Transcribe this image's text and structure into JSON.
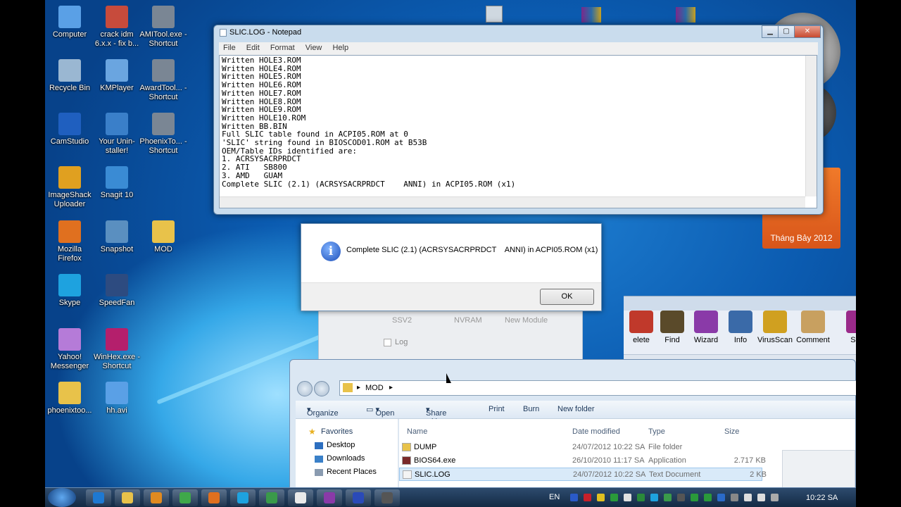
{
  "desktop_icons": [
    {
      "label": "Computer",
      "icon": "computer-icon",
      "color": "#5aa0e6"
    },
    {
      "label": "crack idm 6.x.x - fix b...",
      "icon": "gnome-icon",
      "color": "#c74b3c"
    },
    {
      "label": "AMITool.exe - Shortcut",
      "icon": "amitool-icon",
      "color": "#7a8694"
    },
    {
      "label": "Recycle Bin",
      "icon": "recycle-bin-icon",
      "color": "#9ab7d2"
    },
    {
      "label": "KMPlayer",
      "icon": "kmplayer-icon",
      "color": "#6aa5e0"
    },
    {
      "label": "AwardTool... - Shortcut",
      "icon": "awardtool-icon",
      "color": "#7a8694"
    },
    {
      "label": "CamStudio",
      "icon": "camstudio-icon",
      "color": "#1f5fbf"
    },
    {
      "label": "Your Unin-staller!",
      "icon": "uninstaller-icon",
      "color": "#3a7fc9"
    },
    {
      "label": "PhoenixTo... - Shortcut",
      "icon": "phoenixtool-icon",
      "color": "#7a8694"
    },
    {
      "label": "ImageShack Uploader",
      "icon": "imageshack-icon",
      "color": "#e0a020"
    },
    {
      "label": "Snagit 10",
      "icon": "snagit-icon",
      "color": "#3a8bd4"
    },
    {
      "label": "Mozilla Firefox",
      "icon": "firefox-icon",
      "color": "#e0701f"
    },
    {
      "label": "Snapshot",
      "icon": "snapshot-icon",
      "color": "#5a8fc0"
    },
    {
      "label": "MOD",
      "icon": "folder-icon",
      "color": "#e8c24a"
    },
    {
      "label": "Skype",
      "icon": "skype-icon",
      "color": "#1ea2df"
    },
    {
      "label": "SpeedFan",
      "icon": "speedfan-icon",
      "color": "#2d4b80"
    },
    {
      "label": "Yahoo! Messenger",
      "icon": "yahoo-icon",
      "color": "#b57bd8"
    },
    {
      "label": "WinHex.exe - Shortcut",
      "icon": "winhex-icon",
      "color": "#b41f6c"
    },
    {
      "label": "phoenixtoo...",
      "icon": "folder-icon",
      "color": "#e8c24a"
    },
    {
      "label": "hh.avi",
      "icon": "video-icon",
      "color": "#5aa0e6"
    }
  ],
  "notepad": {
    "title": "SLIC.LOG - Notepad",
    "menu": [
      "File",
      "Edit",
      "Format",
      "View",
      "Help"
    ],
    "lines": [
      "Written HOLE3.ROM",
      "Written HOLE4.ROM",
      "Written HOLE5.ROM",
      "Written HOLE6.ROM",
      "Written HOLE7.ROM",
      "Written HOLE8.ROM",
      "Written HOLE9.ROM",
      "Written HOLE10.ROM",
      "Written BB.BIN",
      "Full SLIC table found in ACPI05.ROM at 0",
      "'SLIC' string found in BIOSCOD01.ROM at B53B",
      "OEM/Table IDs identified are:",
      "1. ACRSYSACRPRDCT",
      "2. ATI   SB800",
      "3. AMD   GUAM",
      "Complete SLIC (2.1) (ACRSYSACRPRDCT    ANNI) in ACPI05.ROM (x1)"
    ]
  },
  "dialog": {
    "message": "Complete SLIC (2.1) (ACRSYSACRPRDCT    ANNI) in ACPI05.ROM (x1)",
    "ok": "OK"
  },
  "calendar": {
    "month": "Tháng Bảy 2012"
  },
  "behind": {
    "options": [
      "SSV2",
      "NVRAM",
      "New Module"
    ],
    "log_label": "Log"
  },
  "winrar_tools": [
    {
      "label": "elete",
      "color": "#c0392b"
    },
    {
      "label": "Find",
      "color": "#5a4a2a"
    },
    {
      "label": "Wizard",
      "color": "#8a3aa8"
    },
    {
      "label": "Info",
      "color": "#3a6aa8"
    },
    {
      "label": "VirusScan",
      "color": "#d0a020"
    },
    {
      "label": "Comment",
      "color": "#c8a060"
    },
    {
      "label": "SFX",
      "color": "#9a2a8a"
    }
  ],
  "explorer": {
    "breadcrumb": "MOD",
    "commands": [
      "Organize",
      "Open",
      "Share with",
      "Print",
      "Burn",
      "New folder"
    ],
    "nav": [
      "Favorites",
      "Desktop",
      "Downloads",
      "Recent Places"
    ],
    "columns": [
      "Name",
      "Date modified",
      "Type",
      "Size"
    ],
    "files": [
      {
        "name": "DUMP",
        "date": "24/07/2012 10:22 SA",
        "type": "File folder",
        "size": ""
      },
      {
        "name": "BIOS64.exe",
        "date": "26/10/2010 11:17 SA",
        "type": "Application",
        "size": "2.717 KB"
      },
      {
        "name": "SLIC.LOG",
        "date": "24/07/2012 10:22 SA",
        "type": "Text Document",
        "size": "2 KB"
      }
    ]
  },
  "taskbar": {
    "lang": "EN",
    "time": "10:22 SA"
  }
}
